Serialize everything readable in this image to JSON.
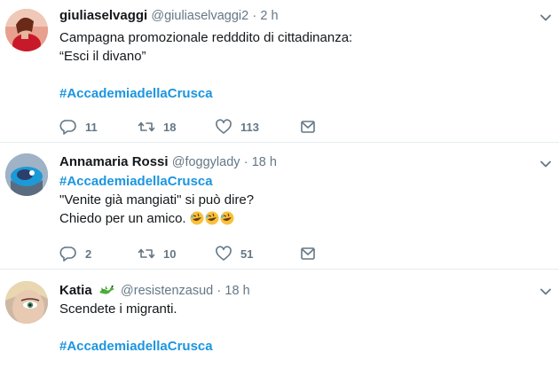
{
  "tweets": [
    {
      "display_name": "giuliaselvaggi",
      "handle": "@giuliaselvaggi2",
      "separator": "·",
      "time": "2 h",
      "lines": [
        "Campagna promozionale redddito di cittadinanza:",
        "“Esci il divano”"
      ],
      "hashtag": "#AccademiadellaCrusca",
      "replies": "11",
      "retweets": "18",
      "likes": "113"
    },
    {
      "display_name": "Annamaria Rossi",
      "handle": "@foggylady",
      "separator": "·",
      "time": "18 h",
      "hashtag": "#AccademiadellaCrusca",
      "line1": "\"Venite già mangiati\" si può dire?",
      "line2": "Chiedo per un amico.",
      "emoji_icon": "rolling-on-floor-laughing-emoji",
      "replies": "2",
      "retweets": "10",
      "likes": "51"
    },
    {
      "display_name": "Katia",
      "badge_icon": "dragon-emoji",
      "handle": "@resistenzasud",
      "separator": "·",
      "time": "18 h",
      "lines": [
        "Scendete i migranti."
      ],
      "hashtag": "#AccademiadellaCrusca"
    }
  ],
  "colors": {
    "hashtag": "#1b95e0",
    "secondary_text": "#657786",
    "divider": "#e6ecf0"
  }
}
